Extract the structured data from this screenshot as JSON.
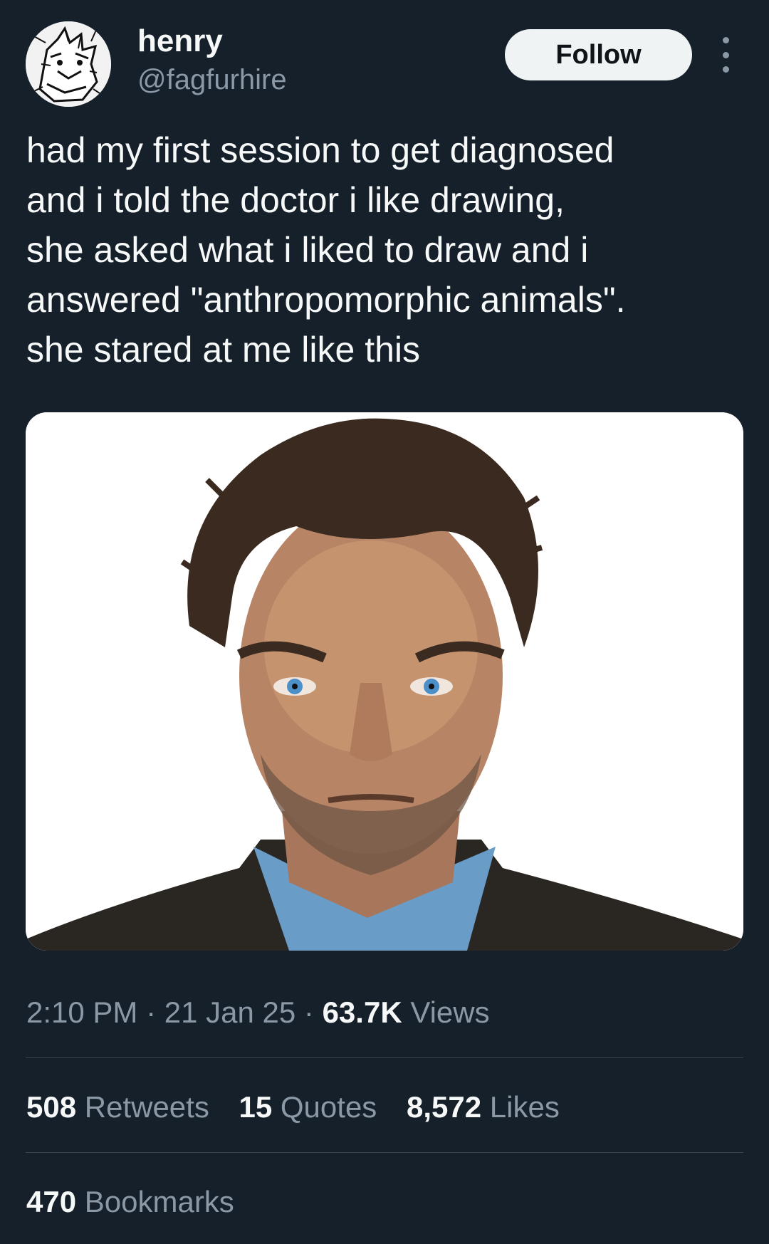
{
  "author": {
    "display_name": "henry",
    "handle": "@fagfurhire"
  },
  "follow_button": {
    "label": "Follow"
  },
  "tweet": {
    "text": "had my first session to get diagnosed\nand i told the doctor i like drawing,\nshe asked what i liked to draw and i\nanswered \"anthropomorphic animals\".\nshe stared at me like this"
  },
  "meta": {
    "time": "2:10 PM",
    "separator": " · ",
    "date": "21 Jan 25",
    "views_count": "63.7K",
    "views_label": "Views"
  },
  "stats": {
    "retweets": {
      "count": "508",
      "label": "Retweets"
    },
    "quotes": {
      "count": "15",
      "label": "Quotes"
    },
    "likes": {
      "count": "8,572",
      "label": "Likes"
    },
    "bookmarks": {
      "count": "470",
      "label": "Bookmarks"
    }
  },
  "colors": {
    "background": "#15202b",
    "text_primary": "#f7f9f9",
    "text_secondary": "#8b98a5",
    "divider": "#38444d",
    "follow_bg": "#eff3f4"
  },
  "icons": {
    "more": "more-vertical-icon"
  }
}
